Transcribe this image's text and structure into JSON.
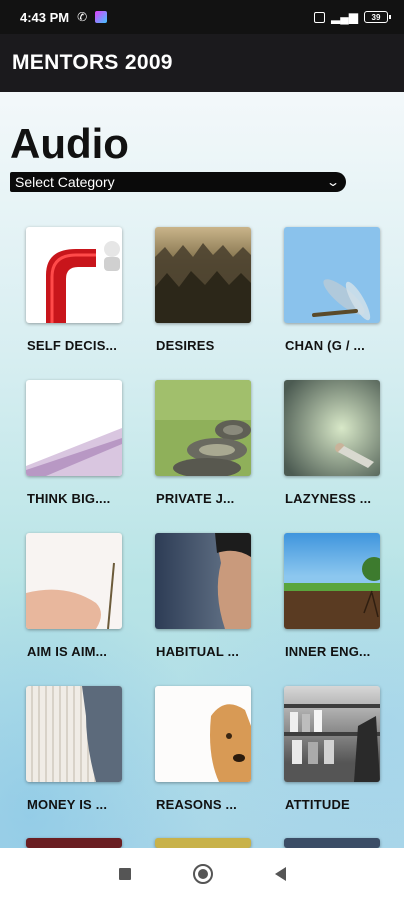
{
  "status_bar": {
    "time": "4:43 PM",
    "battery": "39"
  },
  "app_bar": {
    "title": "MENTORS 2009"
  },
  "page": {
    "title": "Audio",
    "category_select": "Select Category"
  },
  "tiles": [
    {
      "label": "SELF DECIS...",
      "image": "red-arrow-turn"
    },
    {
      "label": "DESIRES",
      "image": "army-crowd"
    },
    {
      "label": "CHAN (G / ...",
      "image": "dragonfly-sky"
    },
    {
      "label": "THINK BIG....",
      "image": "rupee-note"
    },
    {
      "label": "PRIVATE J...",
      "image": "tires-grass"
    },
    {
      "label": "LAZYNESS ...",
      "image": "man-lounging"
    },
    {
      "label": "AIM IS AIM...",
      "image": "finger-needle"
    },
    {
      "label": "HABITUAL ...",
      "image": "man-portrait"
    },
    {
      "label": "INNER ENG...",
      "image": "tree-soil"
    },
    {
      "label": "MONEY IS ...",
      "image": "jeans-pocket"
    },
    {
      "label": "REASONS ...",
      "image": "dog"
    },
    {
      "label": "ATTITUDE",
      "image": "lab-bottles"
    }
  ]
}
